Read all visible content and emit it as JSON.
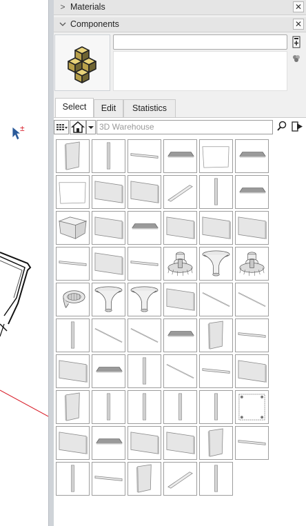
{
  "trays": {
    "materials": {
      "title": "Materials",
      "close": "✕"
    },
    "components": {
      "title": "Components",
      "close": "✕"
    }
  },
  "component": {
    "name_value": "",
    "description": ""
  },
  "tabs": [
    {
      "label": "Select",
      "active": true
    },
    {
      "label": "Edit",
      "active": false
    },
    {
      "label": "Statistics",
      "active": false
    }
  ],
  "search": {
    "placeholder": "3D Warehouse",
    "value": ""
  },
  "viewport": {
    "cursor_mark": "±"
  },
  "icons": {
    "expand": "chevron-right-icon",
    "collapse": "chevron-down-icon",
    "close": "close-icon",
    "view_options": "grid-view-icon",
    "home": "home-icon",
    "navigation": "dropdown-arrow-icon",
    "search": "search-icon",
    "details": "details-arrow-icon",
    "component_preview": "stacked-cubes-icon"
  },
  "components_grid": [
    [
      "panel-tall",
      "post",
      "rail-long",
      "slab-dark",
      "sheet-flat",
      "slab-dark"
    ],
    [
      "sheet-flat",
      "panel-wide",
      "panel-wide",
      "board-angled",
      "post",
      "slab-dark"
    ],
    [
      "box-open",
      "panel-wide",
      "slab-dark",
      "panel-wide",
      "panel-wide",
      "panel-wide"
    ],
    [
      "rail-long",
      "panel-wide",
      "rail-long",
      "lamp-ornate",
      "lamp-vase",
      "lamp-ornate"
    ],
    [
      "lamp-dome",
      "lamp-vase",
      "lamp-vase",
      "panel-wide",
      "rod-diagonal",
      "rod-diagonal"
    ],
    [
      "post",
      "rod-diagonal",
      "rod-diagonal",
      "slab-dark",
      "panel-tall",
      "rail-long"
    ],
    [
      "panel-wide",
      "slab-dark",
      "post",
      "rod-diagonal",
      "rail-long",
      "panel-wide"
    ],
    [
      "panel-tall",
      "post",
      "post",
      "post",
      "post",
      "plate-bolted"
    ],
    [
      "panel-wide",
      "slab-dark",
      "panel-wide",
      "panel-wide",
      "panel-tall",
      "rail-long"
    ],
    [
      "post",
      "rail-long",
      "panel-tall",
      "board-angled",
      "post"
    ]
  ],
  "colors": {
    "panel_bg": "#f0f0f0",
    "tile_border": "#9c9c9c",
    "axis_red": "#d9232e",
    "cursor": "#2a5a9a"
  }
}
